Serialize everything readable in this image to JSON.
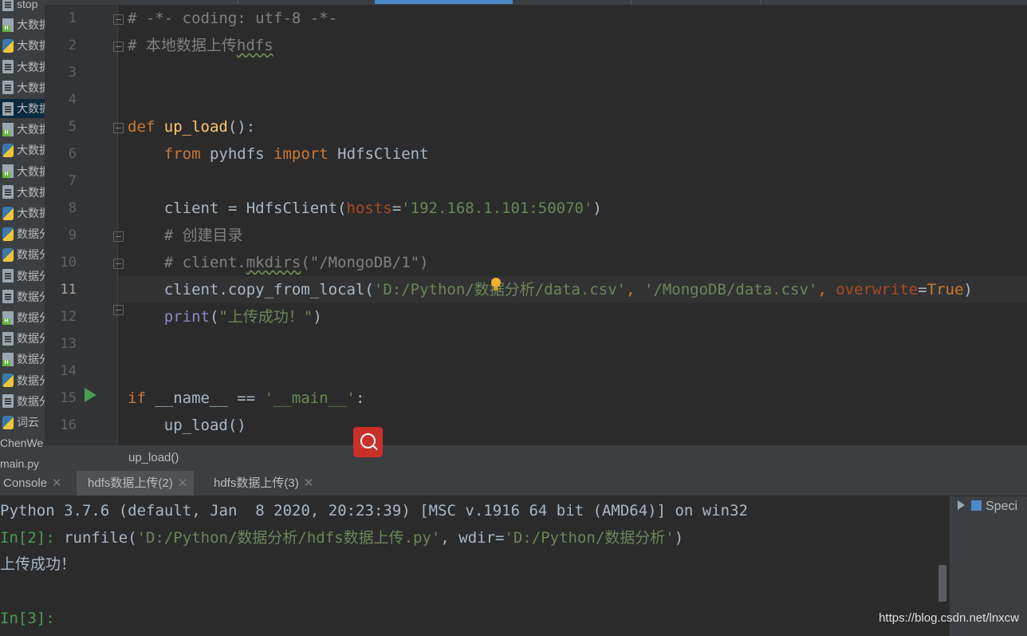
{
  "sidebar": {
    "items": [
      {
        "label": "stop",
        "icon": "document-icon"
      },
      {
        "label": "大数据",
        "icon": "hdfs-file-icon"
      },
      {
        "label": "大数据",
        "icon": "python-file-icon"
      },
      {
        "label": "大数据",
        "icon": "document-icon"
      },
      {
        "label": "大数据",
        "icon": "document-icon"
      },
      {
        "label": "大数据",
        "icon": "document-icon",
        "selected": true
      },
      {
        "label": "大数据",
        "icon": "hdfs-file-icon"
      },
      {
        "label": "大数据",
        "icon": "python-file-icon"
      },
      {
        "label": "大数据",
        "icon": "hdfs-file-icon"
      },
      {
        "label": "大数据",
        "icon": "document-icon"
      },
      {
        "label": "大数据",
        "icon": "python-file-icon"
      },
      {
        "label": "数据分",
        "icon": "python-file-icon"
      },
      {
        "label": "数据分",
        "icon": "python-file-icon"
      },
      {
        "label": "数据分",
        "icon": "document-icon"
      },
      {
        "label": "数据分",
        "icon": "document-icon"
      },
      {
        "label": "数据分",
        "icon": "hdfs-file-icon"
      },
      {
        "label": "数据分",
        "icon": "document-icon"
      },
      {
        "label": "数据分",
        "icon": "hdfs-file-icon"
      },
      {
        "label": "数据分",
        "icon": "python-file-icon"
      },
      {
        "label": "数据分",
        "icon": "document-icon"
      },
      {
        "label": "词云",
        "icon": "python-file-icon"
      },
      {
        "label": "ChenWe",
        "icon": ""
      },
      {
        "label": "main.py",
        "icon": ""
      }
    ]
  },
  "editor": {
    "line_numbers": [
      "1",
      "2",
      "3",
      "4",
      "5",
      "6",
      "7",
      "8",
      "9",
      "10",
      "11",
      "12",
      "13",
      "14",
      "15",
      "16"
    ],
    "current_line": "11",
    "code": {
      "l1": "# -*- coding: utf-8 -*-",
      "l2a": "# 本地数据上传",
      "l2b": "hdfs",
      "l5_kw": "def",
      "l5_fn": "up_load",
      "l5_rest": "():",
      "l6_from": "from",
      "l6_mod": " pyhdfs ",
      "l6_import": "import",
      "l6_cls": " HdfsClient",
      "l8_a": "client = HdfsClient(",
      "l8_param": "hosts",
      "l8_eq": "=",
      "l8_str": "'192.168.1.101:50070'",
      "l8_end": ")",
      "l9": "# 创建目录",
      "l10a": "# client.",
      "l10b": "mkdirs",
      "l10c": "(\"/MongoDB/1\")",
      "l11_a": "client.copy_from_local(",
      "l11_s1": "'D:/Python/数据分析/data.csv'",
      "l11_c1": ", ",
      "l11_s2": "'/MongoDB/data.csv'",
      "l11_c2": ", ",
      "l11_param": "overwrite",
      "l11_eq": "=",
      "l11_true": "True",
      "l11_end": ")",
      "l12_fn": "print",
      "l12_open": "(",
      "l12_str": "\"上传成功！\"",
      "l12_end": ")",
      "l15_if": "if",
      "l15_mid": " __name__ == ",
      "l15_str": "'__main__'",
      "l15_end": ":",
      "l16": "up_load()"
    }
  },
  "breadcrumb": {
    "label": "up_load()"
  },
  "console_tabs": [
    {
      "label": "Console"
    },
    {
      "label": "hdfs数据上传(2)"
    },
    {
      "label": "hdfs数据上传(3)"
    }
  ],
  "console": {
    "banner": "Python 3.7.6 (default, Jan  8 2020, 20:23:39) [MSC v.1916 64 bit (AMD64)] on win32",
    "prompt2": "In[2]: ",
    "cmd_a": "runfile(",
    "cmd_s1": "'D:/Python/数据分析/hdfs数据上传.py'",
    "cmd_b": ", wdir=",
    "cmd_s2": "'D:/Python/数据分析'",
    "cmd_c": ")",
    "output": "上传成功！",
    "prompt3": "In[3]:"
  },
  "side_panel": {
    "label": "Speci"
  },
  "watermark": "https://blog.csdn.net/lnxcw",
  "colors": {
    "keyword": "#cc7832",
    "function": "#ffc66d",
    "string": "#6a8759",
    "comment": "#808080",
    "prompt": "#499c54"
  }
}
